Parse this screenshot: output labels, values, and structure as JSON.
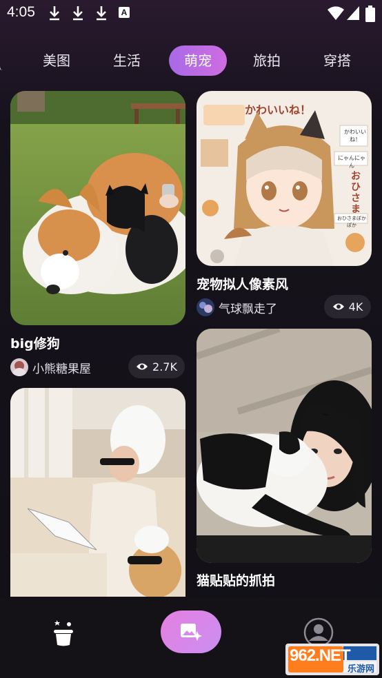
{
  "status_bar": {
    "time": "4:05",
    "badge": "A"
  },
  "tabs": [
    {
      "label": "美图",
      "active": false
    },
    {
      "label": "生活",
      "active": false
    },
    {
      "label": "萌宠",
      "active": true
    },
    {
      "label": "旅拍",
      "active": false
    },
    {
      "label": "穿搭",
      "active": false
    }
  ],
  "cards": [
    {
      "title": "big修狗",
      "author": "小熊糖果屋",
      "views": "2.7K"
    },
    {
      "title": "宠物拟人像素风",
      "author": "气球飘走了",
      "views": "4K"
    },
    {
      "title": "",
      "author": "",
      "views": ""
    },
    {
      "title": "猫贴贴的抓拍",
      "author": "",
      "views": ""
    }
  ],
  "anime_text": {
    "heading": "かわいいね！",
    "bubble1": "かわいいね！",
    "bubble2": "にゃんにゃん",
    "vertical": "おひさま",
    "bottom": "おひさまぽかぽか"
  },
  "watermark": {
    "brand": "962.NET",
    "sub": "乐游网"
  },
  "colors": {
    "accent_start": "#a86ae6",
    "accent_end": "#cf6de2",
    "create_button": "#e67fe2"
  }
}
